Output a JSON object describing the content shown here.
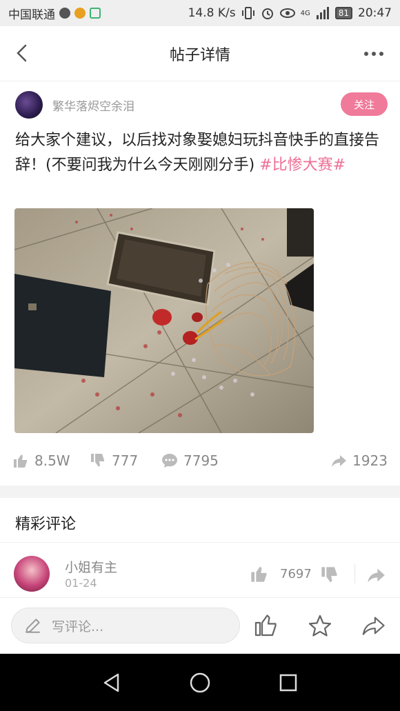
{
  "status_bar": {
    "carrier": "中国联通",
    "network_speed": "14.8 K/s",
    "signal_label": "4G",
    "battery": "81",
    "time": "20:47"
  },
  "nav": {
    "title": "帖子详情"
  },
  "author": {
    "name": "繁华落烬空余泪",
    "follow_label": "关注"
  },
  "post": {
    "text": "给大家个建议，以后找对象娶媳妇玩抖音快手的直接告辞！(不要问我为什么今天刚刚分手) ",
    "tag": "#比惨大赛#"
  },
  "stats": {
    "likes": "8.5W",
    "dislikes": "777",
    "comments": "7795",
    "shares": "1923"
  },
  "comments_section": {
    "title": "精彩评论",
    "items": [
      {
        "name": "小姐有主",
        "date": "01-24",
        "likes": "7697"
      }
    ]
  },
  "bottom_bar": {
    "comment_placeholder": "写评论..."
  },
  "colors": {
    "accent_pink": "#f07a9a",
    "tag_pink": "#ee6e95"
  },
  "icons": [
    "back-arrow-icon",
    "more-icon",
    "thumb-up-icon",
    "thumb-down-icon",
    "comment-bubble-icon",
    "share-arrow-icon",
    "pencil-icon",
    "star-icon"
  ]
}
